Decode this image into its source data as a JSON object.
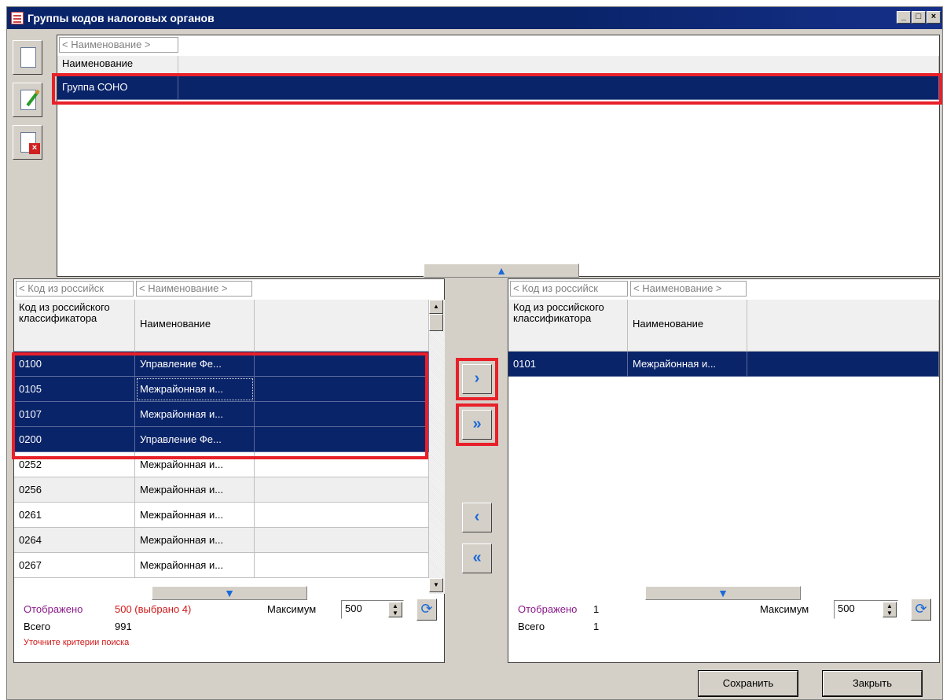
{
  "window": {
    "title": "Группы кодов налоговых органов"
  },
  "titlebar_buttons": {
    "minimize": "_",
    "maximize": "□",
    "close": "×"
  },
  "top_panel": {
    "filter_placeholder": "< Наименование >",
    "column_header": "Наименование",
    "rows": [
      {
        "name": "Группа СОНО",
        "selected": true
      }
    ]
  },
  "left_panel": {
    "filter_code": "< Код из российск",
    "filter_name": "< Наименование >",
    "headers": {
      "code": "Код из российского классификатора",
      "name": "Наименование"
    },
    "rows": [
      {
        "code": "0100",
        "name": "Управление Фе...",
        "selected": true
      },
      {
        "code": "0105",
        "name": "Межрайонная и...",
        "selected": true
      },
      {
        "code": "0107",
        "name": "Межрайонная и...",
        "selected": true
      },
      {
        "code": "0200",
        "name": "Управление Фе...",
        "selected": true
      },
      {
        "code": "0252",
        "name": "Межрайонная и...",
        "selected": false
      },
      {
        "code": "0256",
        "name": "Межрайонная и...",
        "selected": false
      },
      {
        "code": "0261",
        "name": "Межрайонная и...",
        "selected": false
      },
      {
        "code": "0264",
        "name": "Межрайонная и...",
        "selected": false
      },
      {
        "code": "0267",
        "name": "Межрайонная и...",
        "selected": false
      }
    ],
    "status": {
      "shown_label": "Отображено",
      "shown_value": "500 (выбрано 4)",
      "total_label": "Всего",
      "total_value": "991",
      "warning": "Уточните критерии поиска",
      "max_label": "Максимум",
      "max_value": "500"
    }
  },
  "right_panel": {
    "filter_code": "< Код из российск",
    "filter_name": "< Наименование >",
    "headers": {
      "code": "Код из российского классификатора",
      "name": "Наименование"
    },
    "rows": [
      {
        "code": "0101",
        "name": "Межрайонная и...",
        "selected": true
      }
    ],
    "status": {
      "shown_label": "Отображено",
      "shown_value": "1",
      "total_label": "Всего",
      "total_value": "1",
      "max_label": "Максимум",
      "max_value": "500"
    }
  },
  "transfer_buttons": {
    "add_one": "›",
    "add_all": "»",
    "remove_one": "‹",
    "remove_all": "«"
  },
  "footer": {
    "save": "Сохранить",
    "close": "Закрыть"
  },
  "colors": {
    "selection": "#0a246a",
    "highlight": "#e8202a",
    "accent_icon": "#1a6ad8",
    "shown_label": "#8a1a8a",
    "warning": "#d01818"
  }
}
